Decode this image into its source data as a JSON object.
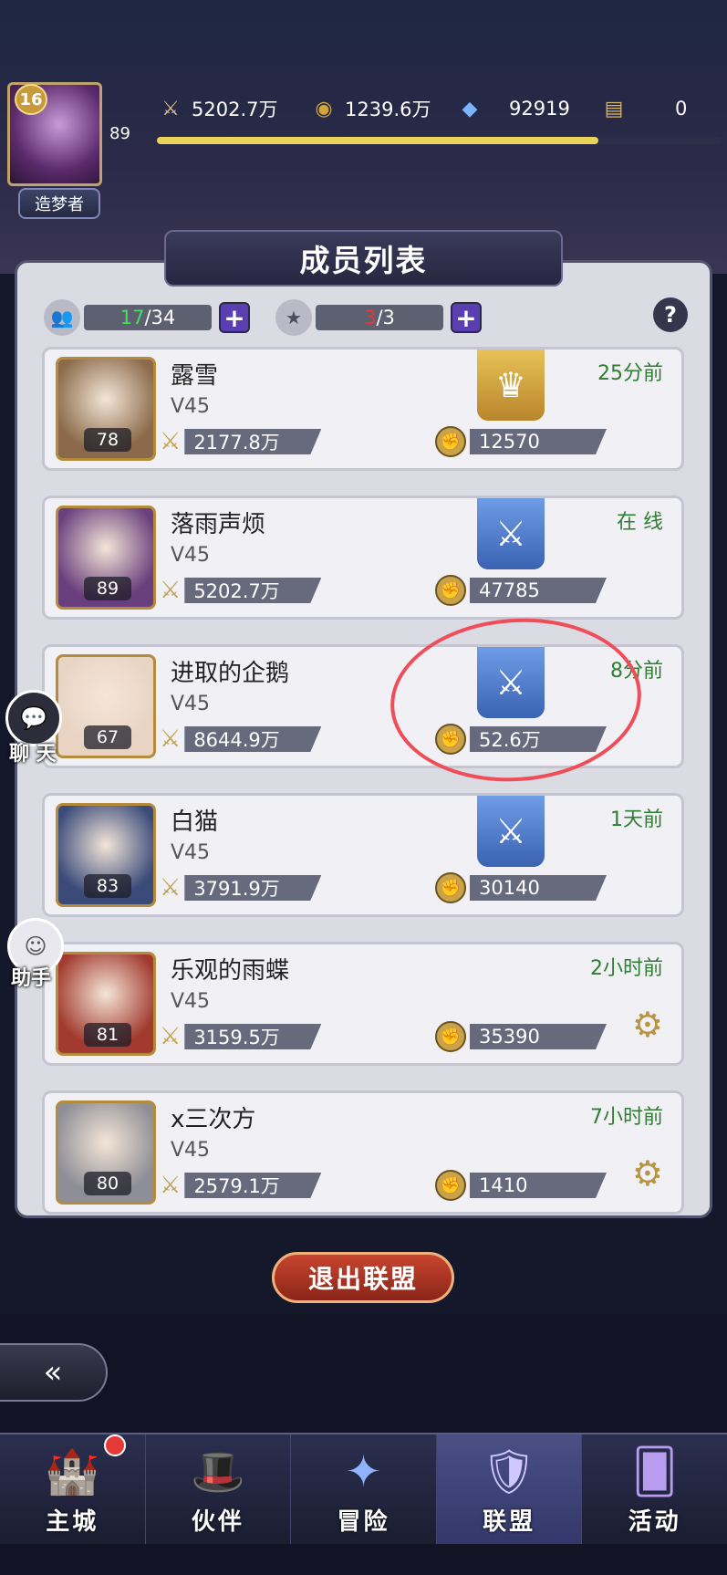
{
  "player": {
    "level": "16",
    "rank_title": "造梦者",
    "number": "89",
    "xp_fraction": 0.78
  },
  "resources": [
    {
      "icon": "sword-icon",
      "value": "5202.7万"
    },
    {
      "icon": "gold-coin-icon",
      "value": "1239.6万"
    },
    {
      "icon": "diamond-icon",
      "value": "92919"
    },
    {
      "icon": "scroll-icon",
      "value": "0"
    }
  ],
  "header": {
    "title": "成员列表"
  },
  "counters": {
    "members": {
      "current": "17",
      "max": "/34"
    },
    "officers": {
      "current": "3",
      "max": "/3"
    }
  },
  "members": [
    {
      "name": "露雪",
      "vip": "V45",
      "level": "78",
      "power": "2177.8万",
      "contribution": "12570",
      "status": "25分前",
      "role": "leader",
      "portrait_color": "#8a6a4a"
    },
    {
      "name": "落雨声烦",
      "vip": "V45",
      "level": "89",
      "power": "5202.7万",
      "contribution": "47785",
      "status": "在 线",
      "role": "officer",
      "portrait_color": "#6a3f7d"
    },
    {
      "name": "进取的企鹅",
      "vip": "V45",
      "level": "67",
      "power": "8644.9万",
      "contribution": "52.6万",
      "status": "8分前",
      "role": "officer",
      "portrait_color": "#e9d3c2"
    },
    {
      "name": "白猫",
      "vip": "V45",
      "level": "83",
      "power": "3791.9万",
      "contribution": "30140",
      "status": "1天前",
      "role": "officer",
      "portrait_color": "#3a4b7a"
    },
    {
      "name": "乐观的雨蝶",
      "vip": "V45",
      "level": "81",
      "power": "3159.5万",
      "contribution": "35390",
      "status": "2小时前",
      "role": "member",
      "portrait_color": "#a23a2f"
    },
    {
      "name": "x三次方",
      "vip": "V45",
      "level": "80",
      "power": "2579.1万",
      "contribution": "1410",
      "status": "7小时前",
      "role": "member",
      "portrait_color": "#8e8e96"
    }
  ],
  "side_buttons": {
    "chat": "聊 天",
    "assistant": "助手"
  },
  "exit_button": "退出联盟",
  "nav": [
    {
      "label": "主城",
      "icon": "castle-icon"
    },
    {
      "label": "伙伴",
      "icon": "partner-hat-icon"
    },
    {
      "label": "冒险",
      "icon": "adventure-compass-icon"
    },
    {
      "label": "联盟",
      "icon": "alliance-shield-icon",
      "active": true
    },
    {
      "label": "活动",
      "icon": "event-cards-icon"
    }
  ]
}
